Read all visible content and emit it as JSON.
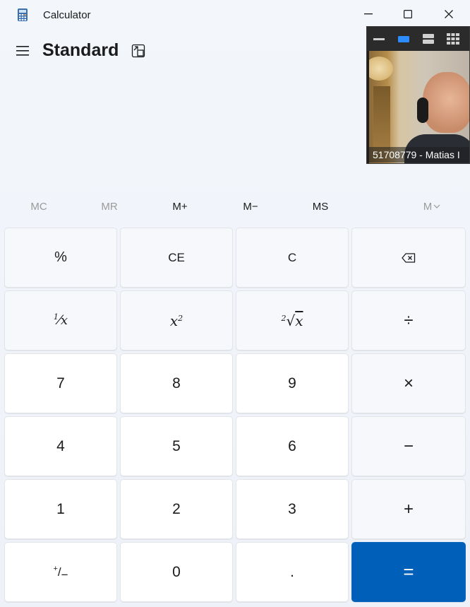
{
  "window": {
    "title": "Calculator",
    "icon": "calculator-app-icon"
  },
  "header": {
    "mode": "Standard",
    "menu_icon": "hamburger-menu-icon",
    "keep_on_top_icon": "keep-on-top-icon"
  },
  "video_overlay": {
    "participant": "51708779 - Matias I",
    "toolbar_icons": [
      "minimize-video-icon",
      "speaker-view-icon",
      "split-view-icon",
      "gallery-view-icon"
    ]
  },
  "memory": {
    "mc": "MC",
    "mr": "MR",
    "mplus": "M+",
    "mminus": "M−",
    "ms": "MS",
    "mlist": "M"
  },
  "keys": {
    "percent": "%",
    "ce": "CE",
    "c": "C",
    "n7": "7",
    "n8": "8",
    "n9": "9",
    "n4": "4",
    "n5": "5",
    "n6": "6",
    "n1": "1",
    "n2": "2",
    "n3": "3",
    "n0": "0",
    "decimal": ".",
    "divide": "÷",
    "multiply": "×",
    "subtract": "−",
    "add": "+",
    "equals": "=",
    "reciprocal_num": "1",
    "reciprocal_den": "x",
    "square_base": "x",
    "square_exp": "2",
    "sqrt_index": "2",
    "sqrt_symbol": "√",
    "sqrt_var": "x",
    "negate_plus": "+",
    "negate_minus": "−"
  },
  "colors": {
    "accent": "#005fb8",
    "background": "#eef2f8"
  }
}
